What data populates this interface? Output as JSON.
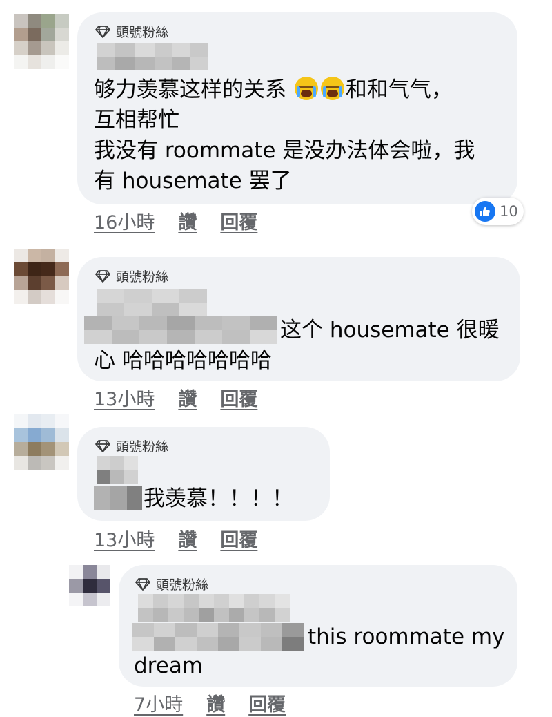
{
  "colors": {
    "bubble_bg": "#f0f2f5",
    "meta_text": "#65676b",
    "like_blue": "#1877f2"
  },
  "comments": [
    {
      "badge": "頭號粉絲",
      "line1_pre": "够力羡慕这样的关系",
      "emojis": [
        "loudly-crying-face",
        "loudly-crying-face"
      ],
      "line1_post": "和和气气，",
      "line2": "互相帮忙",
      "line3": "我没有 roommate 是没办法体会啦，我",
      "line4": "有 housemate 罢了",
      "time": "16小時",
      "like": "讚",
      "reply": "回覆",
      "reaction_count": "10"
    },
    {
      "badge": "頭號粉絲",
      "line1": "这个 housemate 很暖",
      "line2": "心 哈哈哈哈哈哈哈",
      "time": "13小時",
      "like": "讚",
      "reply": "回覆"
    },
    {
      "badge": "頭號粉絲",
      "line1": "我羡慕！！！！",
      "time": "13小時",
      "like": "讚",
      "reply": "回覆"
    },
    {
      "badge": "頭號粉絲",
      "line1": "this roommate my",
      "line2": "dream",
      "time": "7小時",
      "like": "讚",
      "reply": "回覆"
    }
  ]
}
